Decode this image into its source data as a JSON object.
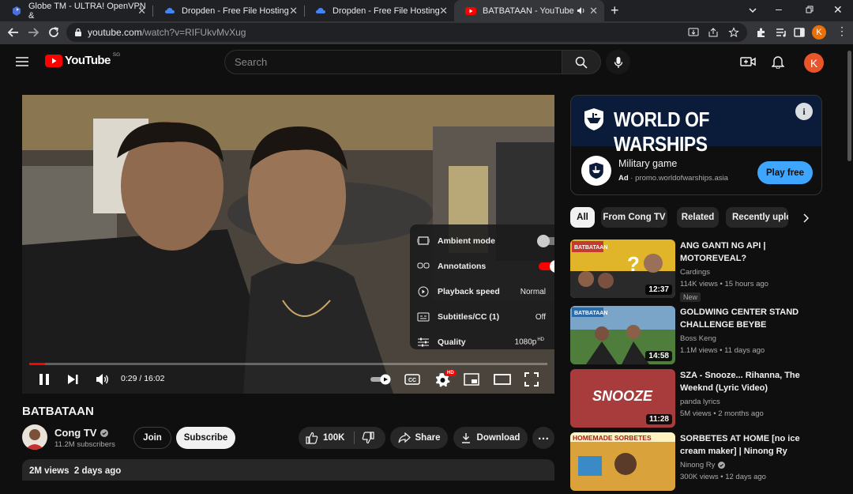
{
  "browser": {
    "tabs": [
      {
        "title": "Globe TM - ULTRA! OpenVPN &"
      },
      {
        "title": "Dropden - Free File Hosting"
      },
      {
        "title": "Dropden - Free File Hosting"
      },
      {
        "title": "BATBATAAN - YouTube"
      }
    ],
    "url_host": "youtube.com",
    "url_path": "/watch?v=RIFUkvMvXug",
    "profile_initial": "K"
  },
  "youtube": {
    "logo_text": "YouTube",
    "region": "SG",
    "search_placeholder": "Search",
    "avatar_initial": "K"
  },
  "player": {
    "time": "0:29 / 16:02",
    "progress": 0.03,
    "settings": [
      {
        "label": "Ambient mode",
        "type": "toggle",
        "on": false
      },
      {
        "label": "Annotations",
        "type": "toggle",
        "on": true
      },
      {
        "label": "Playback speed",
        "value": "Normal"
      },
      {
        "label": "Subtitles/CC (1)",
        "value": "Off"
      },
      {
        "label": "Quality",
        "value": "1080p",
        "badge": "HD"
      }
    ],
    "hd_badge": "HD"
  },
  "video": {
    "title": "BATBATAAN",
    "channel": "Cong TV",
    "subscribers": "11.2M subscribers",
    "join_label": "Join",
    "subscribe_label": "Subscribe",
    "likes": "100K",
    "share_label": "Share",
    "download_label": "Download",
    "views": "2M views",
    "age": "2 days ago"
  },
  "ad": {
    "banner_text": "WORLD OF WARSHIPS",
    "title": "Military game",
    "ad_label": "Ad",
    "domain": "promo.worldofwarships.asia",
    "cta": "Play free"
  },
  "chips": [
    "All",
    "From Cong TV",
    "Related",
    "Recently uploaded"
  ],
  "related": [
    {
      "title": "ANG GANTI NG API | MOTOREVEAL?",
      "channel": "Cardings",
      "views": "114K views",
      "age": "15 hours ago",
      "duration": "12:37",
      "badge": "New",
      "thumb_color": "#e0b52a"
    },
    {
      "title": "GOLDWING CENTER STAND CHALLENGE BEYBE",
      "channel": "Boss Keng",
      "views": "1.1M views",
      "age": "11 days ago",
      "duration": "14:58",
      "thumb_color": "#4f7d3b"
    },
    {
      "title": "SZA - Snooze... Rihanna, The Weeknd (Lyric Video)",
      "channel": "panda lyrics",
      "views": "5M views",
      "age": "2 months ago",
      "duration": "11:28",
      "thumb_color": "#c54a4a"
    },
    {
      "title": "SORBETES AT HOME [no ice cream maker] | Ninong Ry",
      "channel": "Ninong Ry",
      "views": "300K views",
      "age": "12 days ago",
      "thumb_color": "#d9a23a"
    }
  ],
  "thumb_texts": [
    "BATBATAAN",
    "SNOOZE",
    "HOMEMADE SORBETES"
  ],
  "colors": {
    "accent_red": "#ff0000",
    "play_blue": "#3ea6ff",
    "avatar_orange": "#e8552a"
  }
}
